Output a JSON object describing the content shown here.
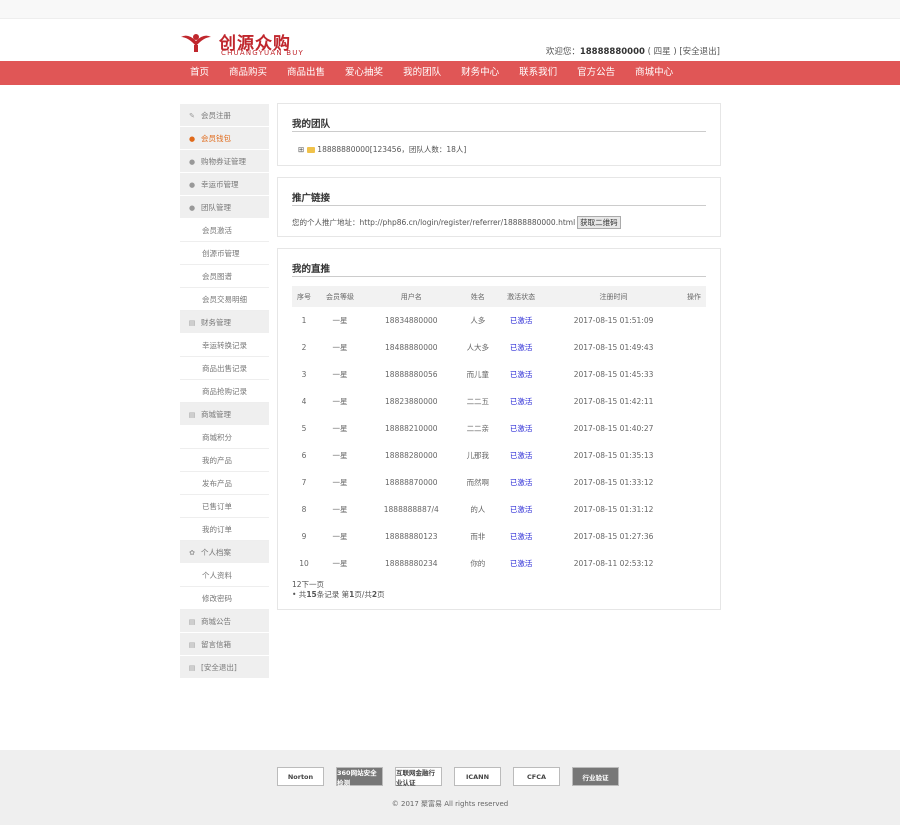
{
  "header": {
    "logo_cn": "创源众购",
    "logo_en": "CHUANGYUAN BUY",
    "welcome_prefix": "欢迎您：",
    "phone": "18888880000",
    "level": "( 四星 )",
    "logout": "[安全退出]"
  },
  "nav": [
    "首页",
    "商品购买",
    "商品出售",
    "爱心抽奖",
    "我的团队",
    "财务中心",
    "联系我们",
    "官方公告",
    "商城中心"
  ],
  "sidebar": [
    {
      "label": "会员注册",
      "type": "head",
      "icon": "edit-icon"
    },
    {
      "label": "会员钱包",
      "type": "head",
      "icon": "user-icon",
      "active": true
    },
    {
      "label": "购物券证管理",
      "type": "head",
      "icon": "user-icon"
    },
    {
      "label": "幸运币管理",
      "type": "head",
      "icon": "user-icon"
    },
    {
      "label": "团队管理",
      "type": "head",
      "icon": "user-icon"
    },
    {
      "label": "会员激活",
      "type": "sub"
    },
    {
      "label": "创源币管理",
      "type": "sub"
    },
    {
      "label": "会员图谱",
      "type": "sub"
    },
    {
      "label": "会员交易明细",
      "type": "sub"
    },
    {
      "label": "财务管理",
      "type": "head",
      "icon": "doc-icon"
    },
    {
      "label": "幸运转换记录",
      "type": "sub"
    },
    {
      "label": "商品出售记录",
      "type": "sub"
    },
    {
      "label": "商品抢购记录",
      "type": "sub"
    },
    {
      "label": "商城管理",
      "type": "head",
      "icon": "doc-icon"
    },
    {
      "label": "商城积分",
      "type": "sub"
    },
    {
      "label": "我的产品",
      "type": "sub"
    },
    {
      "label": "发布产品",
      "type": "sub"
    },
    {
      "label": "已售订单",
      "type": "sub"
    },
    {
      "label": "我的订单",
      "type": "sub"
    },
    {
      "label": "个人档案",
      "type": "head",
      "icon": "gear-icon"
    },
    {
      "label": "个人资料",
      "type": "sub"
    },
    {
      "label": "修改密码",
      "type": "sub"
    },
    {
      "label": "商城公告",
      "type": "head",
      "icon": "doc-icon"
    },
    {
      "label": "留言信箱",
      "type": "head",
      "icon": "doc-icon"
    },
    {
      "label": "[安全退出]",
      "type": "head",
      "icon": "doc-icon"
    }
  ],
  "team": {
    "title": "我的团队",
    "node": "18888880000[123456，团队人数：18人]"
  },
  "promo": {
    "title": "推广链接",
    "label": "您的个人推广地址：",
    "url": "http://php86.cn/login/register/referrer/18888880000.html",
    "button": "获取二维码"
  },
  "direct": {
    "title": "我的直推",
    "columns": [
      "序号",
      "会员等级",
      "用户名",
      "姓名",
      "激活状态",
      "注册时间",
      "操作"
    ],
    "rows": [
      [
        "1",
        "一星",
        "18834880000",
        "人多",
        "已激活",
        "2017-08-15 01:51:09",
        ""
      ],
      [
        "2",
        "一星",
        "18488880000",
        "人大多",
        "已激活",
        "2017-08-15 01:49:43",
        ""
      ],
      [
        "3",
        "一星",
        "18888880056",
        "而儿童",
        "已激活",
        "2017-08-15 01:45:33",
        ""
      ],
      [
        "4",
        "一星",
        "18823880000",
        "二二五",
        "已激活",
        "2017-08-15 01:42:11",
        ""
      ],
      [
        "5",
        "一星",
        "18888210000",
        "二二亲",
        "已激活",
        "2017-08-15 01:40:27",
        ""
      ],
      [
        "6",
        "一星",
        "18888280000",
        "儿那我",
        "已激活",
        "2017-08-15 01:35:13",
        ""
      ],
      [
        "7",
        "一星",
        "18888870000",
        "而然啊",
        "已激活",
        "2017-08-15 01:33:12",
        ""
      ],
      [
        "8",
        "一星",
        "1888888887/4",
        "的人",
        "已激活",
        "2017-08-15 01:31:12",
        ""
      ],
      [
        "9",
        "一星",
        "18888880123",
        "而非",
        "已激活",
        "2017-08-15 01:27:36",
        ""
      ],
      [
        "10",
        "一星",
        "18888880234",
        "你的",
        "已激活",
        "2017-08-11 02:53:12",
        ""
      ]
    ],
    "pager_line1": "12下一页",
    "pager_prefix": "• 共",
    "pager_total": "15",
    "pager_mid": "条记录 第",
    "pager_page": "1",
    "pager_mid2": "页/共",
    "pager_pages": "2",
    "pager_suffix": "页"
  },
  "footer": {
    "badges": [
      "Norton",
      "360网站安全检测",
      "互联网金融行业认证",
      "ICANN",
      "CFCA",
      "行业验证"
    ],
    "copyright": "© 2017 聚富易 All rights reserved"
  },
  "colors": {
    "nav": "#e05656",
    "brand": "#c0272d",
    "active": "#e06a1a",
    "status": "#2b2bd6"
  }
}
